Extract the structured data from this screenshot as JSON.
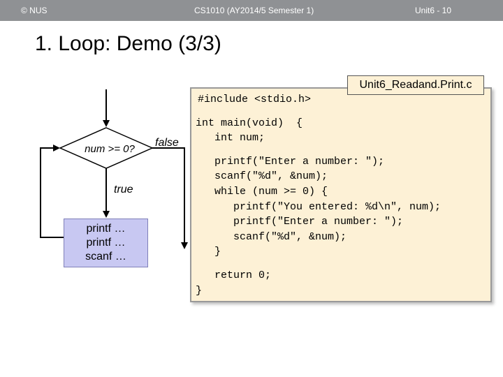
{
  "header": {
    "copyright": "© NUS",
    "course": "CS1010 (AY2014/5 Semester 1)",
    "unit": "Unit6 - 10",
    "background": "#8f9194"
  },
  "title": "1. Loop: Demo (3/3)",
  "flowchart": {
    "condition": "num >= 0?",
    "true_label": "true",
    "false_label": "false",
    "body_lines": [
      "printf …",
      "printf …",
      "scanf …"
    ],
    "body_color": "#c8c8f2"
  },
  "code": {
    "filename": "Unit6_Readand.Print.c",
    "background": "#fdf1d6",
    "lines": [
      "#include <stdio.h>",
      "int main(void)  {",
      "   int num;",
      "   printf(\"Enter a number: \");",
      "   scanf(\"%d\", &num);",
      "   while (num >= 0) {",
      "      printf(\"You entered: %d\\n\", num);",
      "      printf(\"Enter a number: \");",
      "      scanf(\"%d\", &num);",
      "   }",
      "   return 0;",
      "}"
    ]
  }
}
